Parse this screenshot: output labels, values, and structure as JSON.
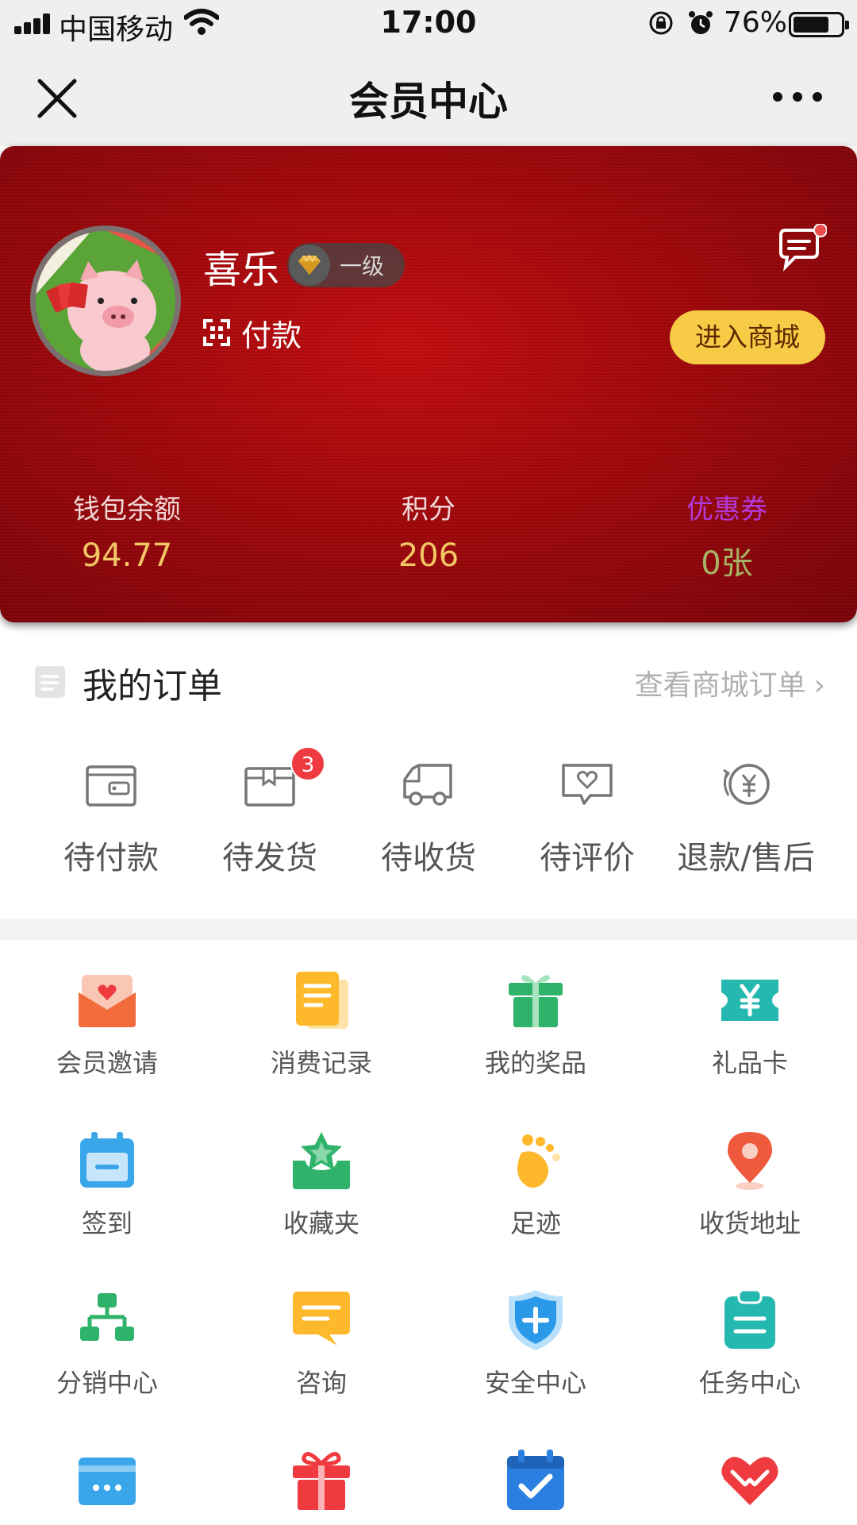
{
  "status_bar": {
    "carrier": "中国移动",
    "time": "17:00",
    "battery_text": "76%",
    "battery_level": 0.76
  },
  "nav": {
    "title": "会员中心",
    "close_icon": "close-icon",
    "more_icon": "more-icon"
  },
  "member": {
    "name": "喜乐",
    "level": "一级",
    "pay_label": "付款",
    "shop_button": "进入商城",
    "stats": {
      "wallet_label": "钱包余额",
      "wallet_value": "94.77",
      "points_label": "积分",
      "points_value": "206",
      "coupon_label": "优惠券",
      "coupon_value": "0张"
    },
    "colors": {
      "card": "#b00a0e",
      "button": "#f7cb45",
      "stat_value": "#f3c765",
      "coupon_label": "#b33ad9",
      "coupon_value": "#a7b366"
    }
  },
  "orders": {
    "title": "我的订单",
    "view_all": "查看商城订单",
    "items": [
      {
        "label": "待付款",
        "icon": "wallet-icon"
      },
      {
        "label": "待发货",
        "icon": "package-icon",
        "badge": "3"
      },
      {
        "label": "待收货",
        "icon": "truck-icon"
      },
      {
        "label": "待评价",
        "icon": "review-icon"
      },
      {
        "label": "退款/售后",
        "icon": "refund-icon"
      }
    ]
  },
  "functions": [
    {
      "label": "会员邀请",
      "icon": "invite-envelope-icon",
      "color": "#f26b3a"
    },
    {
      "label": "消费记录",
      "icon": "receipt-icon",
      "color": "#fdb92b"
    },
    {
      "label": "我的奖品",
      "icon": "gift-box-icon",
      "color": "#2fb36a"
    },
    {
      "label": "礼品卡",
      "icon": "gift-card-icon",
      "color": "#25b8b0"
    },
    {
      "label": "签到",
      "icon": "checkin-calendar-icon",
      "color": "#3aa6ea"
    },
    {
      "label": "收藏夹",
      "icon": "favorites-icon",
      "color": "#2fb36a"
    },
    {
      "label": "足迹",
      "icon": "footprint-icon",
      "color": "#fdb92b"
    },
    {
      "label": "收货地址",
      "icon": "location-pin-icon",
      "color": "#f05a3c"
    },
    {
      "label": "分销中心",
      "icon": "distribution-icon",
      "color": "#2fb36a"
    },
    {
      "label": "咨询",
      "icon": "chat-icon",
      "color": "#fdb92b"
    },
    {
      "label": "安全中心",
      "icon": "shield-icon",
      "color": "#2a9ae8"
    },
    {
      "label": "任务中心",
      "icon": "clipboard-icon",
      "color": "#25b8b0"
    },
    {
      "label": "",
      "icon": "card-icon",
      "color": "#3aa6ea"
    },
    {
      "label": "",
      "icon": "gift-icon",
      "color": "#ef3b3f"
    },
    {
      "label": "",
      "icon": "calendar-check-icon",
      "color": "#2a7fe0"
    },
    {
      "label": "",
      "icon": "heart-icon",
      "color": "#ef3b3f"
    }
  ]
}
